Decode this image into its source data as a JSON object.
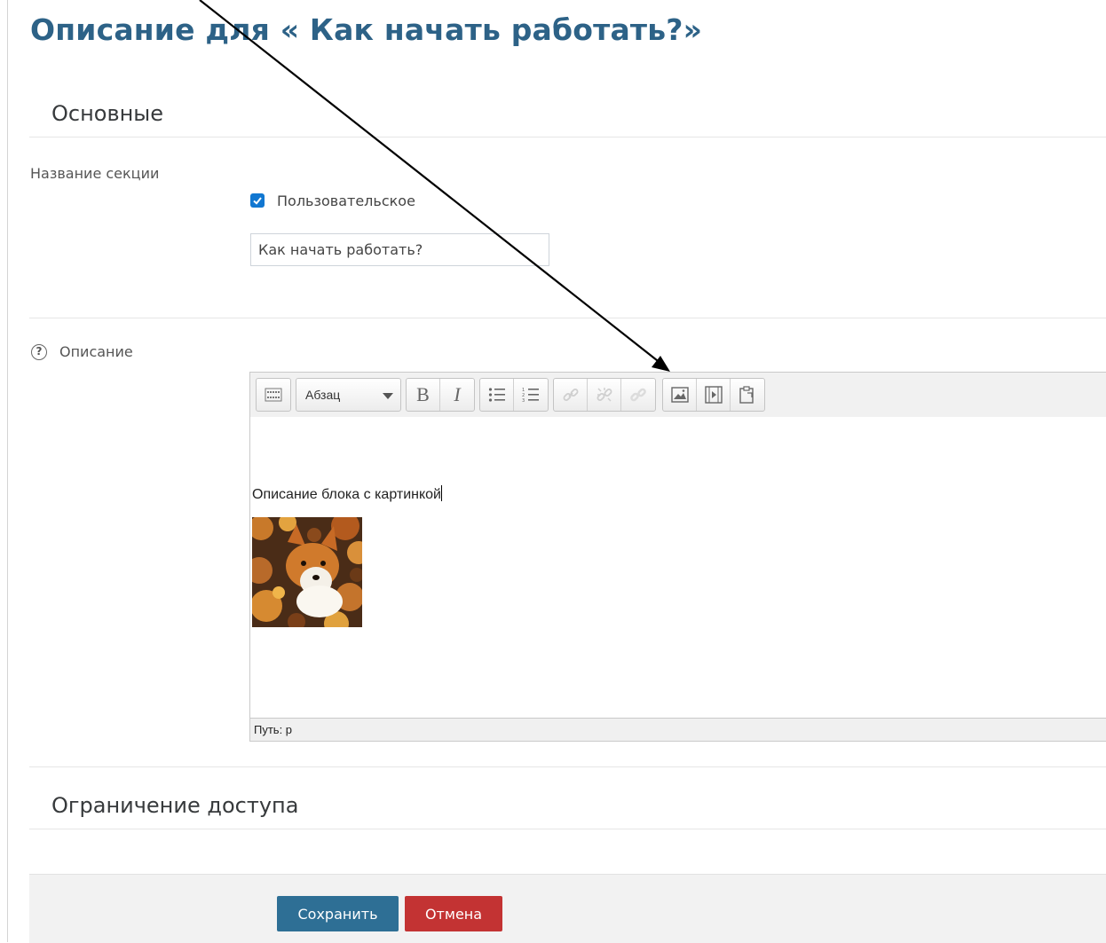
{
  "page": {
    "title": "Описание для « Как начать работать?»"
  },
  "general": {
    "heading": "Основные",
    "section_name_label": "Название секции",
    "custom_checkbox_label": "Пользовательское",
    "custom_checked": true,
    "section_name_value": "Как начать работать?",
    "description_label": "Описание",
    "help_icon": "?"
  },
  "editor": {
    "format_select_value": "Абзац",
    "toolbar_icons": [
      "toolbar-toggle-icon",
      "bold-icon",
      "italic-icon",
      "unordered-list-icon",
      "ordered-list-icon",
      "link-icon",
      "unlink-icon",
      "anchor-icon",
      "image-icon",
      "media-icon",
      "paste-icon"
    ],
    "bold_glyph": "B",
    "italic_glyph": "I",
    "content_text": "Описание блока с картинкой",
    "content_image": "corgi-photo",
    "path_label": "Путь: p"
  },
  "restrict": {
    "heading": "Ограничение доступа"
  },
  "actions": {
    "save_label": "Сохранить",
    "cancel_label": "Отмена",
    "save_color": "#2e6f95",
    "cancel_color": "#c33333"
  },
  "colors": {
    "title": "#2d6287",
    "checkbox": "#1177d1"
  }
}
